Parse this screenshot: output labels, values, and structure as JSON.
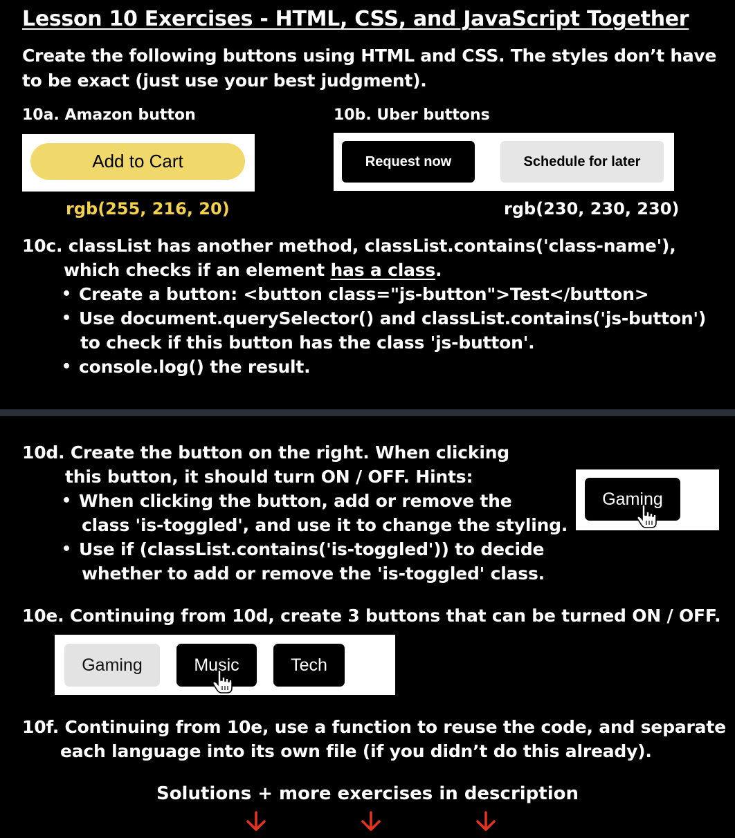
{
  "title": "Lesson 10 Exercises - HTML, CSS, and JavaScript Together",
  "intro": "Create the following buttons using HTML and CSS. The styles don’t have to be exact (just use your best judgment).",
  "ex10a": {
    "label": "10a. Amazon button",
    "button_label": "Add to Cart",
    "color_note": "rgb(255, 216, 20)"
  },
  "ex10b": {
    "label": "10b. Uber buttons",
    "primary_label": "Request now",
    "secondary_label": "Schedule for later",
    "color_note": "rgb(230, 230, 230)"
  },
  "ex10c": {
    "line1": "10c. classList has another method, classList.contains('class-name'),",
    "line2_prefix": "which checks if an element ",
    "line2_link": "has a class",
    "line2_suffix": ".",
    "bullet1": "Create a button: <button class=\"js-button\">Test</button>",
    "bullet2_line1": "Use document.querySelector() and classList.contains('js-button')",
    "bullet2_line2": "to check if this button has the class 'js-button'.",
    "bullet3": "console.log() the result."
  },
  "ex10d": {
    "line1": "10d. Create the button on the right. When clicking",
    "line2": "this button, it should turn ON / OFF. Hints:",
    "bullet1_line1": "When clicking the button, add or remove the",
    "bullet1_line2": "class 'is-toggled', and use it to change the styling.",
    "bullet2_line1": "Use if (classList.contains('is-toggled')) to decide",
    "bullet2_line2": "whether to add or remove the 'is-toggled' class.",
    "demo_button": "Gaming"
  },
  "ex10e": {
    "text": "10e. Continuing from 10d, create 3 buttons that can be turned ON / OFF.",
    "buttons": [
      "Gaming",
      "Music",
      "Tech"
    ]
  },
  "ex10f": {
    "line1": "10f. Continuing from 10e, use a function to reuse the code, and separate",
    "line2": "each language into its own file (if you didn’t do this already)."
  },
  "footer": {
    "solutions": "Solutions + more exercises in description",
    "arrow_icon": "down-arrow-icon",
    "arrow_color": "#e8321e"
  },
  "colors": {
    "amazon_yellow": "#f0d96a",
    "uber_gray": "#e6e6e6",
    "note_yellow": "#f3d14a"
  }
}
